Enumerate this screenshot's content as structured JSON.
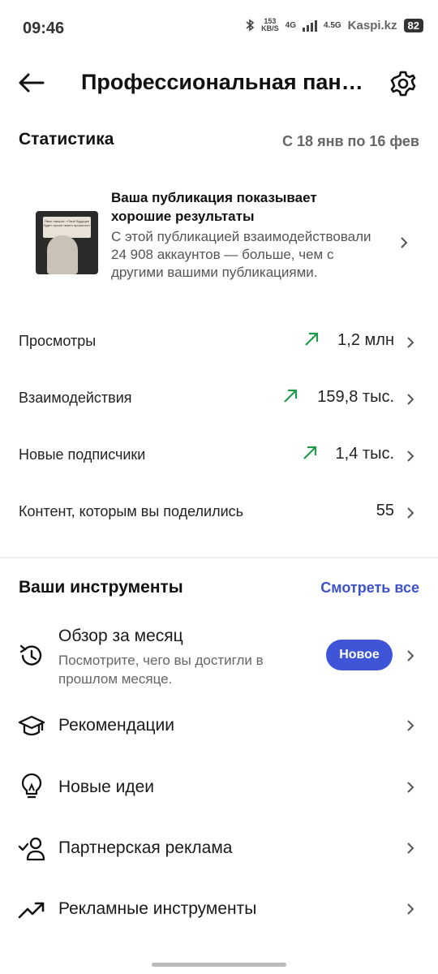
{
  "status_bar": {
    "time": "09:46",
    "speed_value": "153",
    "speed_unit": "KB/S",
    "network": "4G",
    "network2": "4.5G",
    "watermark": "Kaspi.kz",
    "battery": "82"
  },
  "header": {
    "title": "Профессиональная пане…"
  },
  "stats": {
    "title": "Статистика",
    "date_range": "С 18 янв по 16 фев",
    "highlight": {
      "title": "Ваша публикация показывает хорошие результаты",
      "description": "С этой публикацией взаимодействовали 24 908 аккаунтов — больше, чем с другими вашими публикациями.",
      "thumbnail_text": "Явно говорит: «Твоё будущее будет лучше твоего прошлого»"
    },
    "metrics": [
      {
        "label": "Просмотры",
        "value": "1,2 млн",
        "trend": "up"
      },
      {
        "label": "Взаимодействия",
        "value": "159,8 тыс.",
        "trend": "up"
      },
      {
        "label": "Новые подписчики",
        "value": "1,4 тыс.",
        "trend": "up"
      },
      {
        "label": "Контент, которым вы поделились",
        "value": "55",
        "trend": "none"
      }
    ]
  },
  "tools": {
    "title": "Ваши инструменты",
    "see_all": "Смотреть все",
    "items": [
      {
        "title": "Обзор за месяц",
        "subtitle": "Посмотрите, чего вы достигли в прошлом месяце.",
        "badge": "Новое",
        "icon": "history-icon"
      },
      {
        "title": "Рекомендации",
        "icon": "graduation-cap-icon"
      },
      {
        "title": "Новые идеи",
        "icon": "lightbulb-icon"
      },
      {
        "title": "Партнерская реклама",
        "icon": "partner-user-check-icon"
      },
      {
        "title": "Рекламные инструменты",
        "icon": "trending-up-icon"
      }
    ]
  },
  "colors": {
    "accent": "#3d55d6",
    "link": "#3f51c7",
    "trend_up": "#1f9a4a"
  }
}
